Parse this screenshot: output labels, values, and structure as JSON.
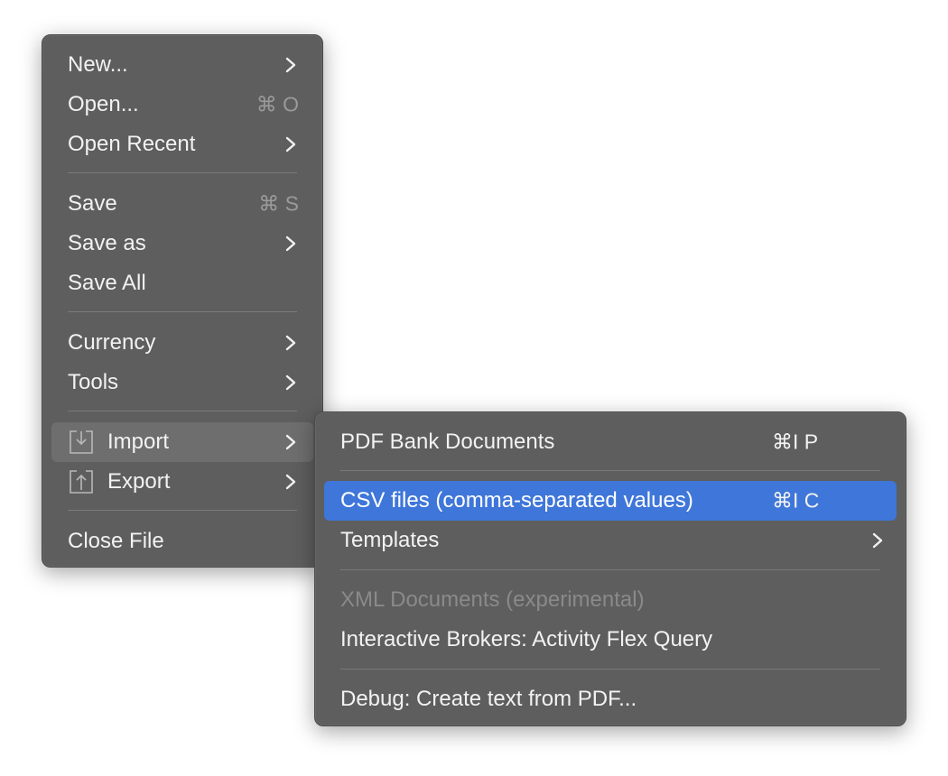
{
  "main_menu": {
    "items": [
      {
        "label": "New...",
        "submenu": true
      },
      {
        "label": "Open...",
        "shortcut": "⌘ O"
      },
      {
        "label": "Open Recent",
        "submenu": true
      },
      {
        "label": "Save",
        "shortcut": "⌘ S"
      },
      {
        "label": "Save as",
        "submenu": true
      },
      {
        "label": "Save All"
      },
      {
        "label": "Currency",
        "submenu": true
      },
      {
        "label": "Tools",
        "submenu": true
      },
      {
        "label": "Import",
        "submenu": true,
        "icon": "import-icon",
        "state": "hover"
      },
      {
        "label": "Export",
        "submenu": true,
        "icon": "export-icon"
      },
      {
        "label": "Close File"
      }
    ]
  },
  "import_submenu": {
    "items": [
      {
        "label": "PDF Bank Documents",
        "shortcut": "⌘I P"
      },
      {
        "label": "CSV files (comma-separated values)",
        "shortcut": "⌘I C",
        "state": "selected"
      },
      {
        "label": "Templates",
        "submenu": true
      },
      {
        "label": "XML Documents (experimental)",
        "state": "disabled"
      },
      {
        "label": "Interactive Brokers: Activity Flex Query"
      },
      {
        "label": "Debug: Create text from PDF..."
      }
    ]
  },
  "colors": {
    "menu_background": "#5e5e5e",
    "selection": "#3f76d9",
    "hover": "#6e6e6e",
    "text": "#f2f2f2",
    "disabled_text": "#8a8a8a",
    "shortcut_text": "#9a9a9a"
  }
}
